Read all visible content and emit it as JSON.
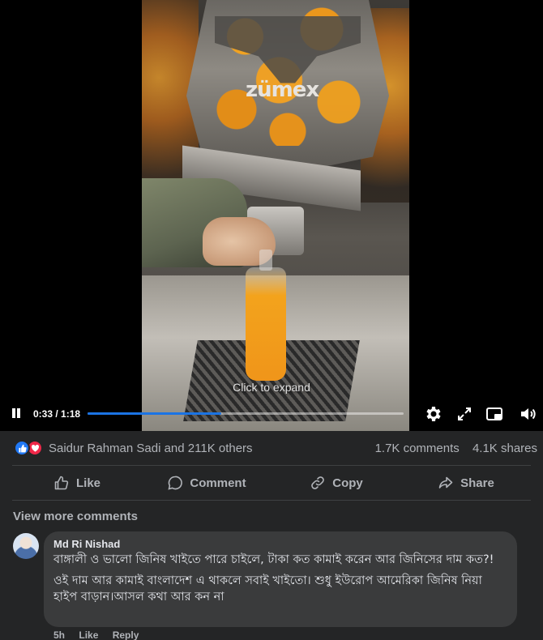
{
  "video": {
    "brand_text": "zümex",
    "expand_hint": "Click to expand",
    "time": "0:33 / 1:18",
    "progress_fraction": 0.423,
    "icons": [
      "pause-icon",
      "settings-icon",
      "fullscreen-icon",
      "pip-icon",
      "volume-icon"
    ]
  },
  "reactions": {
    "names": "Saidur Rahman Sadi and 211K others",
    "comments": "1.7K comments",
    "shares": "4.1K shares"
  },
  "actions": {
    "like": "Like",
    "comment": "Comment",
    "copy": "Copy",
    "share": "Share"
  },
  "comments_section": {
    "view_more": "View more comments",
    "comment": {
      "author": "Md Ri Nishad",
      "line1": "বাঙ্গালী ও ভালো জিনিষ খাইতে পারে চাইলে, টাকা কত কামাই করেন আর জিনিসের দাম কত?!",
      "line2": "ওই দাম আর কামাই বাংলাদেশ এ থাকলে সবাই খাইতো। শুধু ইউরোপ আমেরিকা জিনিষ নিয়া হাইপ বাড়ান।আসল কথা আর কন না",
      "time": "5h",
      "like": "Like",
      "reply": "Reply"
    }
  },
  "colors": {
    "background": "#242526",
    "bubble": "#3a3b3c",
    "accent": "#1b74e4",
    "like_blue": "#2078f4",
    "love_red": "#f02849"
  }
}
